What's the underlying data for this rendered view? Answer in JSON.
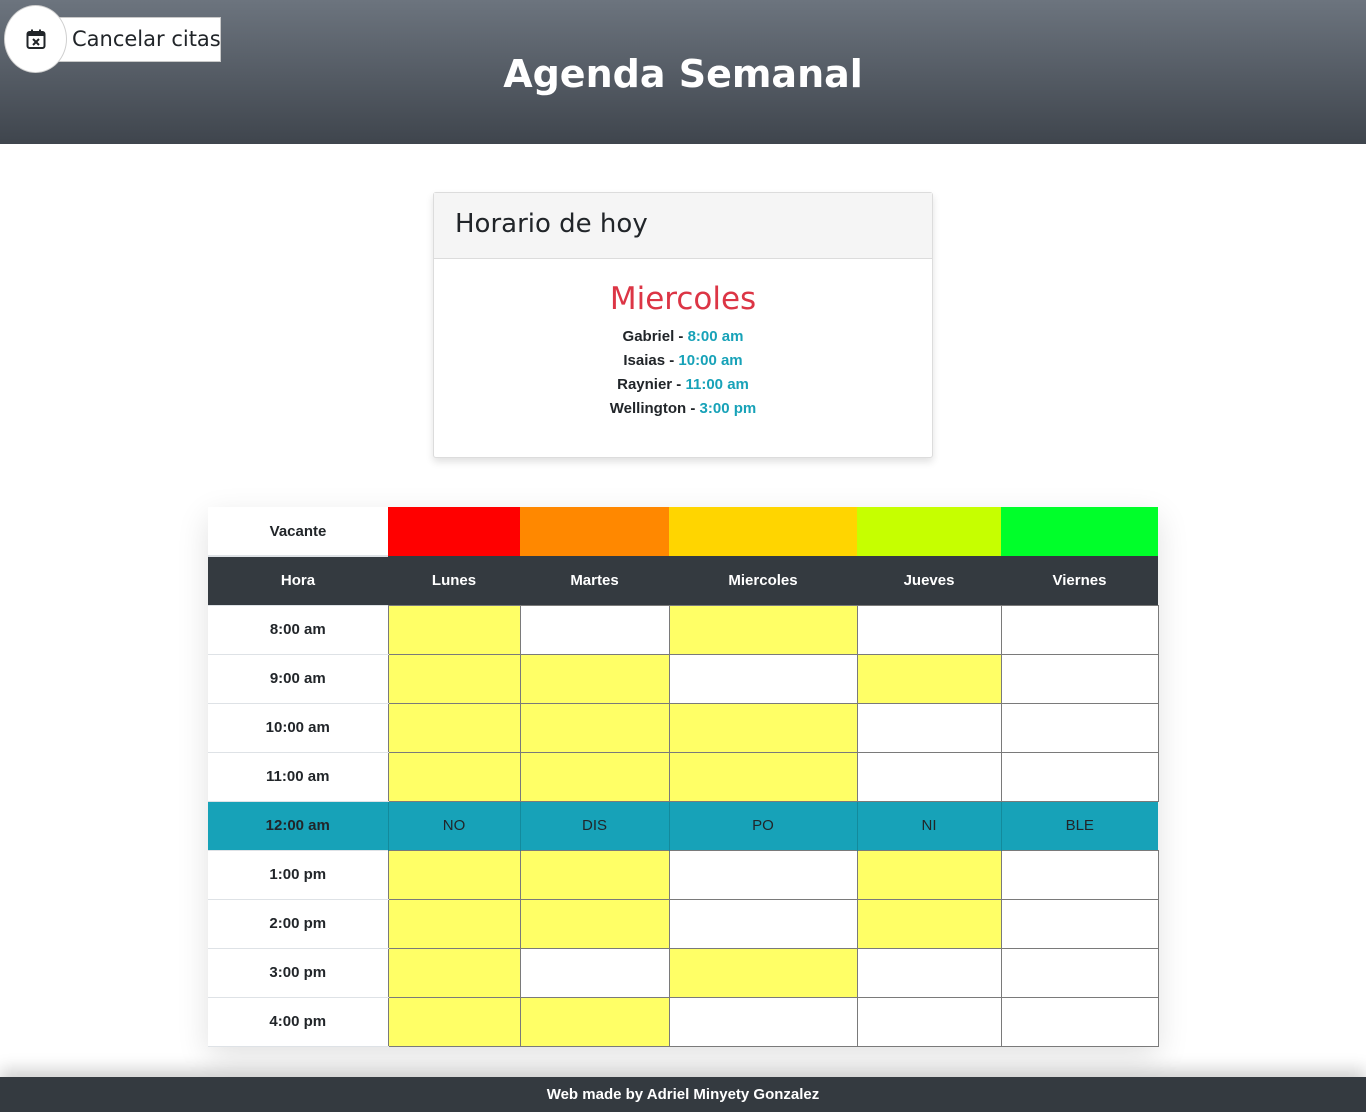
{
  "header": {
    "title": "Agenda Semanal",
    "cancel_label": "Cancelar citas",
    "cancel_icon": "calendar-x-icon"
  },
  "today": {
    "card_title": "Horario de hoy",
    "day": "Miercoles",
    "appointments": [
      {
        "name": "Gabriel",
        "time": "8:00 am"
      },
      {
        "name": "Isaias",
        "time": "10:00 am"
      },
      {
        "name": "Raynier",
        "time": "11:00 am"
      },
      {
        "name": "Wellington",
        "time": "3:00 pm"
      }
    ]
  },
  "schedule": {
    "legend_label": "Vacante",
    "legend_colors": [
      "#ff0000",
      "#ff8800",
      "#ffd500",
      "#c6ff00",
      "#00ff2a"
    ],
    "columns": [
      "Hora",
      "Lunes",
      "Martes",
      "Miercoles",
      "Jueves",
      "Viernes"
    ],
    "rows": [
      {
        "hour": "8:00 am",
        "slots": [
          1,
          0,
          1,
          0,
          0
        ]
      },
      {
        "hour": "9:00 am",
        "slots": [
          1,
          1,
          0,
          1,
          0
        ]
      },
      {
        "hour": "10:00 am",
        "slots": [
          1,
          1,
          1,
          0,
          0
        ]
      },
      {
        "hour": "11:00 am",
        "slots": [
          1,
          1,
          1,
          0,
          0
        ]
      },
      {
        "hour": "12:00 am",
        "lunch": [
          "NO",
          "DIS",
          "PO",
          "NI",
          "BLE"
        ]
      },
      {
        "hour": "1:00 pm",
        "slots": [
          1,
          1,
          0,
          1,
          0
        ]
      },
      {
        "hour": "2:00 pm",
        "slots": [
          1,
          1,
          0,
          1,
          0
        ]
      },
      {
        "hour": "3:00 pm",
        "slots": [
          1,
          0,
          1,
          0,
          0
        ]
      },
      {
        "hour": "4:00 pm",
        "slots": [
          1,
          1,
          0,
          0,
          0
        ]
      }
    ],
    "busy_color": "#ffff66",
    "free_color": "#ffffff",
    "lunch_color": "#17a2b8"
  },
  "footer": {
    "text": "Web made by Adriel Minyety Gonzalez"
  }
}
